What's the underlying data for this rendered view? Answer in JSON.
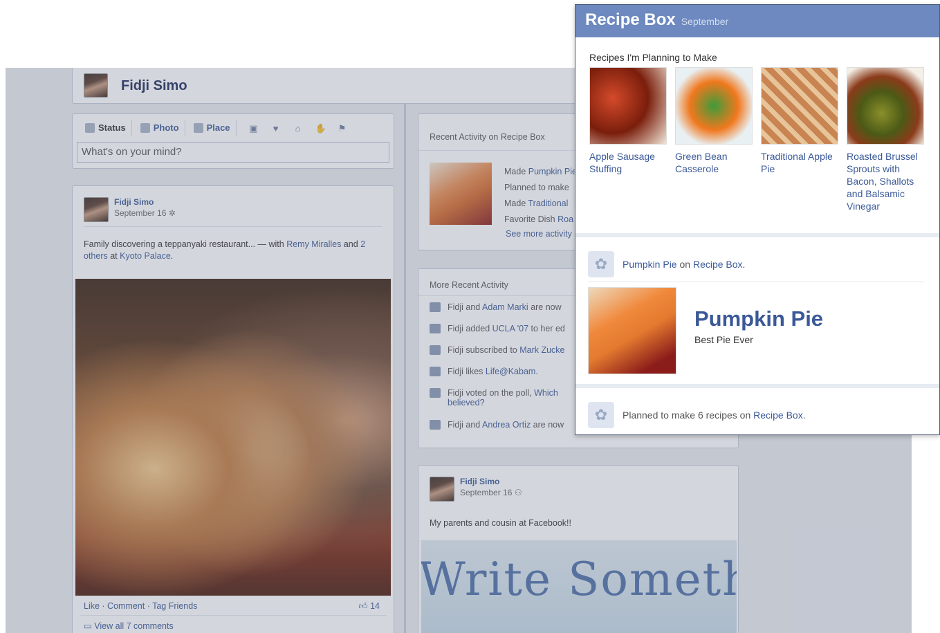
{
  "timeline": {
    "profile_name": "Fidji Simo",
    "composer": {
      "tabs": [
        "Status",
        "Photo",
        "Place"
      ],
      "placeholder": "What's on your mind?"
    },
    "post1": {
      "author": "Fidji Simo",
      "date": "September 16",
      "text_before": "Family discovering a teppanyaki restaurant... — with ",
      "tag_person": "Remy Miralles",
      "text_and": " and ",
      "tag_others": "2 others",
      "text_at": " at ",
      "place": "Kyoto Palace",
      "text_end": ".",
      "actions": "Like · Comment · Tag Friends",
      "like_count": "14",
      "view_comments": "View all 7 comments"
    },
    "recent": {
      "header": "Recent Activity on Recipe Box",
      "lines": [
        {
          "prefix": "Made ",
          "link": "Pumpkin Pie"
        },
        {
          "prefix": "Planned to make ",
          "link": ""
        },
        {
          "prefix": "Made ",
          "link": "Traditional"
        },
        {
          "prefix": "Favorite Dish ",
          "link": "Roa"
        }
      ],
      "see_more": "See more activity"
    },
    "more_recent": {
      "header": "More Recent Activity",
      "items": [
        {
          "text": "Fidji and ",
          "link": "Adam Marki",
          "rest": " are now"
        },
        {
          "text": "Fidji added ",
          "link": "UCLA '07",
          "rest": " to her ed"
        },
        {
          "text": "Fidji subscribed to ",
          "link": "Mark Zucke",
          "rest": ""
        },
        {
          "text": "Fidji likes ",
          "link": "Life@Kabam",
          "rest": "."
        },
        {
          "text": "Fidji voted on the poll, ",
          "link": "Which",
          "rest": ""
        },
        {
          "text": "Fidji and ",
          "link": "Andrea Ortiz",
          "rest": " are now"
        }
      ],
      "poll_cont": "believed?"
    },
    "post2": {
      "author": "Fidji Simo",
      "date": "September 16",
      "text": "My parents and cousin at Facebook!!",
      "photo_text": "Write Somethi"
    }
  },
  "popup": {
    "title": "Recipe Box",
    "month": "September",
    "section_title": "Recipes I'm Planning to Make",
    "recipes": [
      {
        "name": "Apple Sausage Stuffing"
      },
      {
        "name": "Green Bean Casserole"
      },
      {
        "name": "Traditional Apple Pie"
      },
      {
        "name": "Roasted Brussel Sprouts with Bacon, Shallots and Balsamic Vinegar"
      }
    ],
    "story1": {
      "link": "Pumpkin Pie",
      "mid": " on ",
      "app": "Recipe Box",
      "end": "."
    },
    "feature": {
      "title": "Pumpkin Pie",
      "subtitle": "Best Pie Ever"
    },
    "story2": {
      "text": "Planned to make 6 recipes on ",
      "app": "Recipe Box",
      "end": "."
    }
  }
}
